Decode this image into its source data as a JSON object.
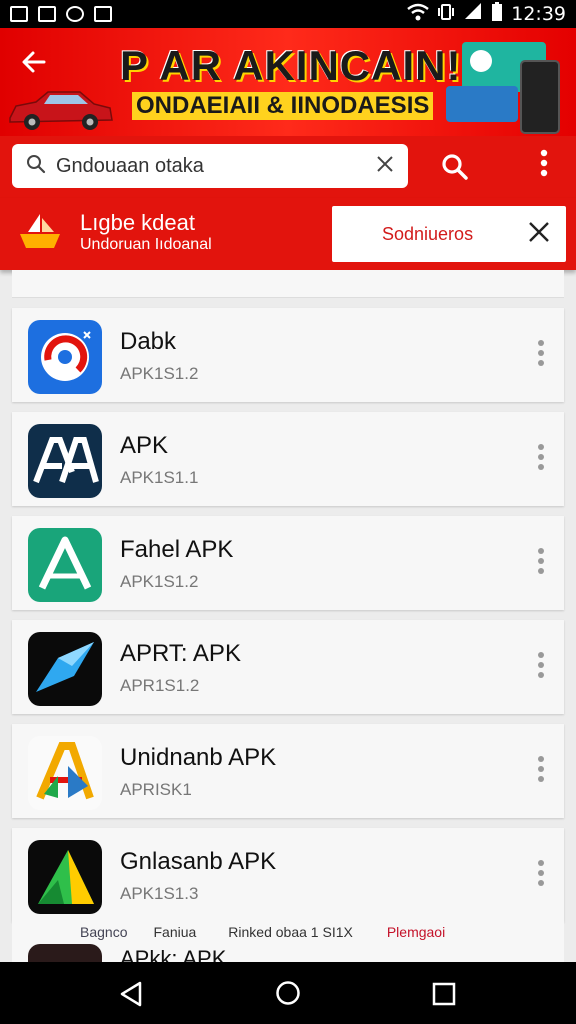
{
  "status_bar": {
    "time": "12:39"
  },
  "banner": {
    "title": "P AR AKINCAIN!",
    "subtitle": "ONDAEIAII & IINODAESIS"
  },
  "search": {
    "query": "Gndouaan otaka"
  },
  "notification": {
    "title": "Lıgbe kdeat",
    "subtitle": "Undoruan Iıdoanal",
    "action_label": "Sodniueros"
  },
  "apps": [
    {
      "name": "Dabk",
      "version": "APK1S1.2",
      "icon": "red-swirl-app-icon"
    },
    {
      "name": "APK",
      "version": "APK1S1.1",
      "icon": "aa-letters-app-icon"
    },
    {
      "name": "Fahel APK",
      "version": "APK1S1.2",
      "icon": "green-a-app-icon"
    },
    {
      "name": "APRT: APK",
      "version": "APR1S1.2",
      "icon": "blue-crystal-app-icon"
    },
    {
      "name": "Unidnanb APK",
      "version": "APRISK1",
      "icon": "colorful-a-app-icon"
    },
    {
      "name": "Gnlasanb APK",
      "version": "APK1S1.3",
      "icon": "green-triangle-app-icon"
    }
  ],
  "bottom_labels": [
    "Bagnco",
    "Faniua",
    "Rinked obaa 1 SI1X",
    "Plemgaoi"
  ],
  "partial_app": {
    "name": "APkk: APK"
  },
  "colors": {
    "brand_red": "#e2140d",
    "accent_yellow": "#ffd21e"
  }
}
